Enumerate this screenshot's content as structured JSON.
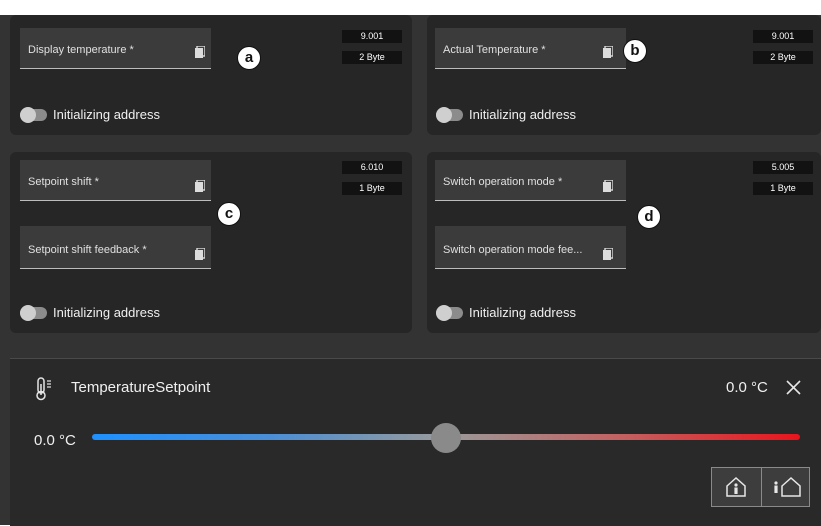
{
  "cards": [
    {
      "marker": "a",
      "fields": [
        "Display temperature *"
      ],
      "dpt": "9.001",
      "size": "2 Byte",
      "toggle_label": "Initializing address"
    },
    {
      "marker": "b",
      "fields": [
        "Actual Temperature *"
      ],
      "dpt": "9.001",
      "size": "2 Byte",
      "toggle_label": "Initializing address"
    },
    {
      "marker": "c",
      "fields": [
        "Setpoint shift *",
        "Setpoint shift feedback *"
      ],
      "dpt": "6.010",
      "size": "1 Byte",
      "toggle_label": "Initializing address"
    },
    {
      "marker": "d",
      "fields": [
        "Switch operation mode *",
        "Switch operation mode fee..."
      ],
      "dpt": "5.005",
      "size": "1 Byte",
      "toggle_label": "Initializing address"
    }
  ],
  "panel": {
    "icon": "thermometer-icon",
    "title": "TemperatureSetpoint",
    "value": "0.0 °C",
    "close_icon": "close-icon",
    "slider_min": "0.0 °C",
    "slider_position": 0.5,
    "track_colors": [
      "#1e90ff",
      "#e8141c"
    ],
    "mode_buttons": [
      "person-in-house-icon",
      "person-leaving-house-icon"
    ]
  }
}
